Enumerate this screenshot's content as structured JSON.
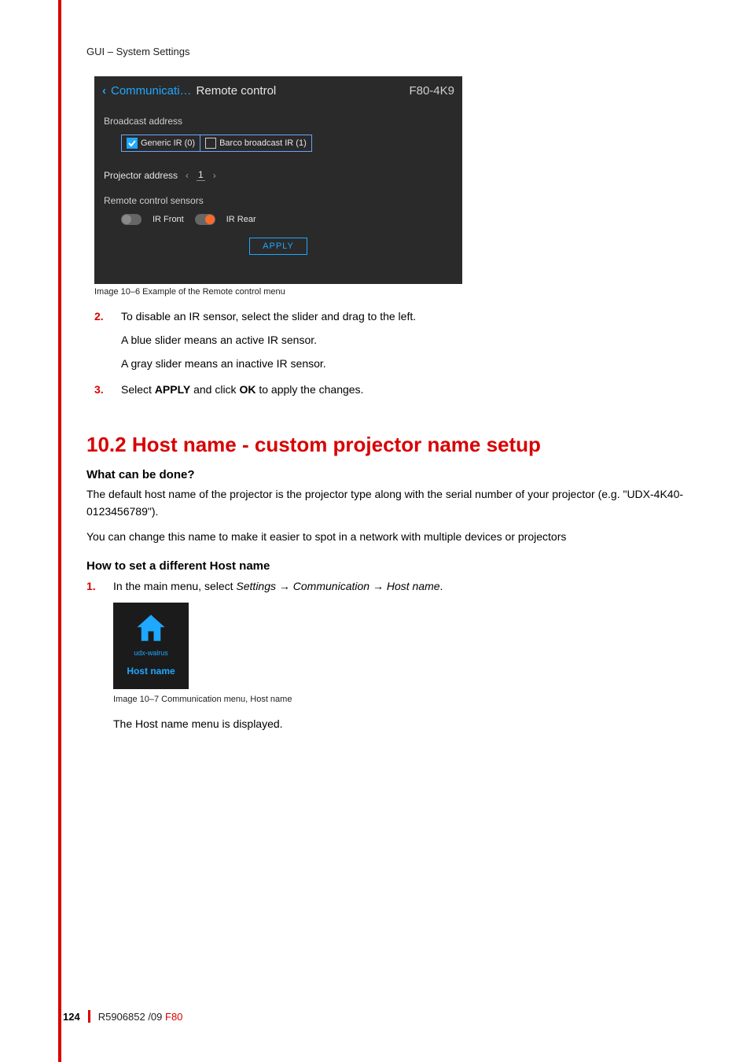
{
  "breadcrumb": "GUI – System Settings",
  "rc": {
    "back": "‹",
    "communicati": "Communicati…",
    "title": "Remote control",
    "model": "F80-4K9",
    "broadcast_label": "Broadcast address",
    "generic_ir": "Generic IR (0)",
    "barco_ir": "Barco broadcast IR (1)",
    "projector_address_label": "Projector address",
    "proj_lt": "‹",
    "proj_num": "1",
    "proj_gt": "›",
    "sensors_label": "Remote control sensors",
    "ir_front": "IR Front",
    "ir_rear": "IR Rear",
    "apply": "APPLY"
  },
  "caption1": "Image 10–6  Example of the Remote control menu",
  "steps_a": {
    "s2_num": "2.",
    "s2_a": "To disable an IR sensor, select the slider and drag to the left.",
    "s2_b": "A blue slider means an active IR sensor.",
    "s2_c": "A gray slider means an inactive IR sensor.",
    "s3_num": "3.",
    "s3_a_pre": "Select ",
    "s3_a_apply": "APPLY",
    "s3_a_mid": " and click ",
    "s3_a_ok": "OK",
    "s3_a_post": " to apply the changes."
  },
  "section_title": "10.2 Host name - custom projector name setup",
  "what_heading": "What can be done?",
  "what_p1": "The default host name of the projector is the projector type along with the serial number of your projector (e.g. \"UDX-4K40-0123456789\").",
  "what_p2": "You can change this name to make it easier to spot in a network with multiple devices or projectors",
  "how_heading": "How to set a different Host name",
  "step1": {
    "num": "1.",
    "pre": "In the main menu, select ",
    "path": "Settings → Communication → Host name",
    "post": "."
  },
  "host_tile": {
    "sub": "udx-walrus",
    "main": "Host name"
  },
  "caption2": "Image 10–7  Communication menu, Host name",
  "step1_after": "The Host name menu is displayed.",
  "footer": {
    "page": "124",
    "doc": "R5906852 /09",
    "model": "F80"
  }
}
